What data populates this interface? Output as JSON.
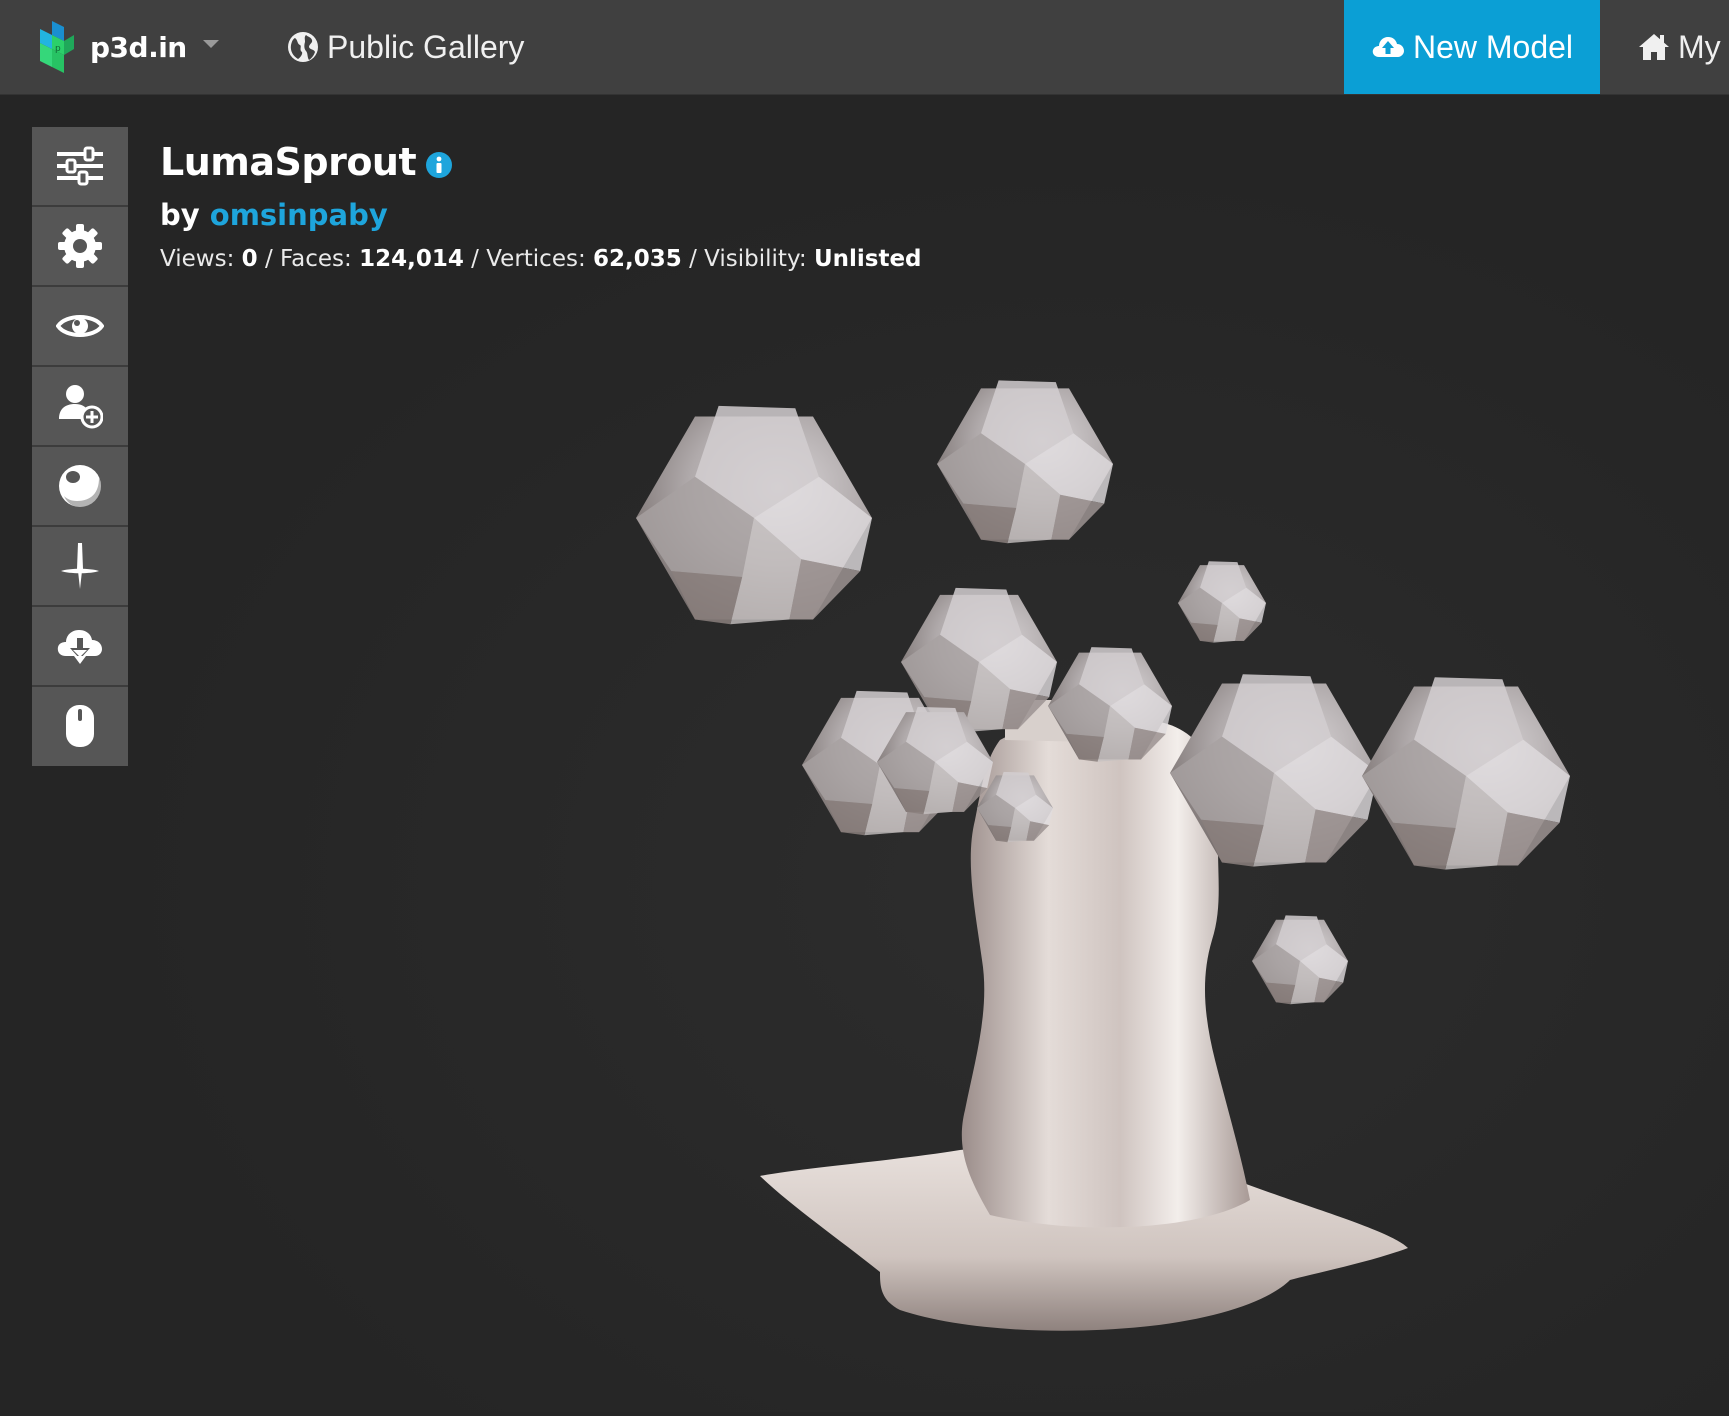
{
  "brand": {
    "name": "p3d.in"
  },
  "nav": {
    "gallery_label": "Public Gallery",
    "new_model_label": "New Model",
    "my_label": "My"
  },
  "toolbar": {
    "tools": [
      {
        "icon": "sliders-icon"
      },
      {
        "icon": "gear-icon"
      },
      {
        "icon": "eye-icon"
      },
      {
        "icon": "add-user-icon"
      },
      {
        "icon": "material-sphere-icon"
      },
      {
        "icon": "pin-icon"
      },
      {
        "icon": "cloud-download-icon"
      },
      {
        "icon": "mouse-icon"
      }
    ]
  },
  "model": {
    "title": "LumaSprout",
    "by_label": "by",
    "author": "omsinpaby",
    "views_label": "Views:",
    "views": "0",
    "faces_label": "Faces:",
    "faces": "124,014",
    "vertices_label": "Vertices:",
    "vertices": "62,035",
    "visibility_label": "Visibility:",
    "visibility": "Unlisted",
    "separator": "/"
  },
  "colors": {
    "accent": "#0b9fd5",
    "link": "#1ea5dc",
    "topbar": "#404040",
    "background": "#252525",
    "toolbar": "#565656"
  }
}
